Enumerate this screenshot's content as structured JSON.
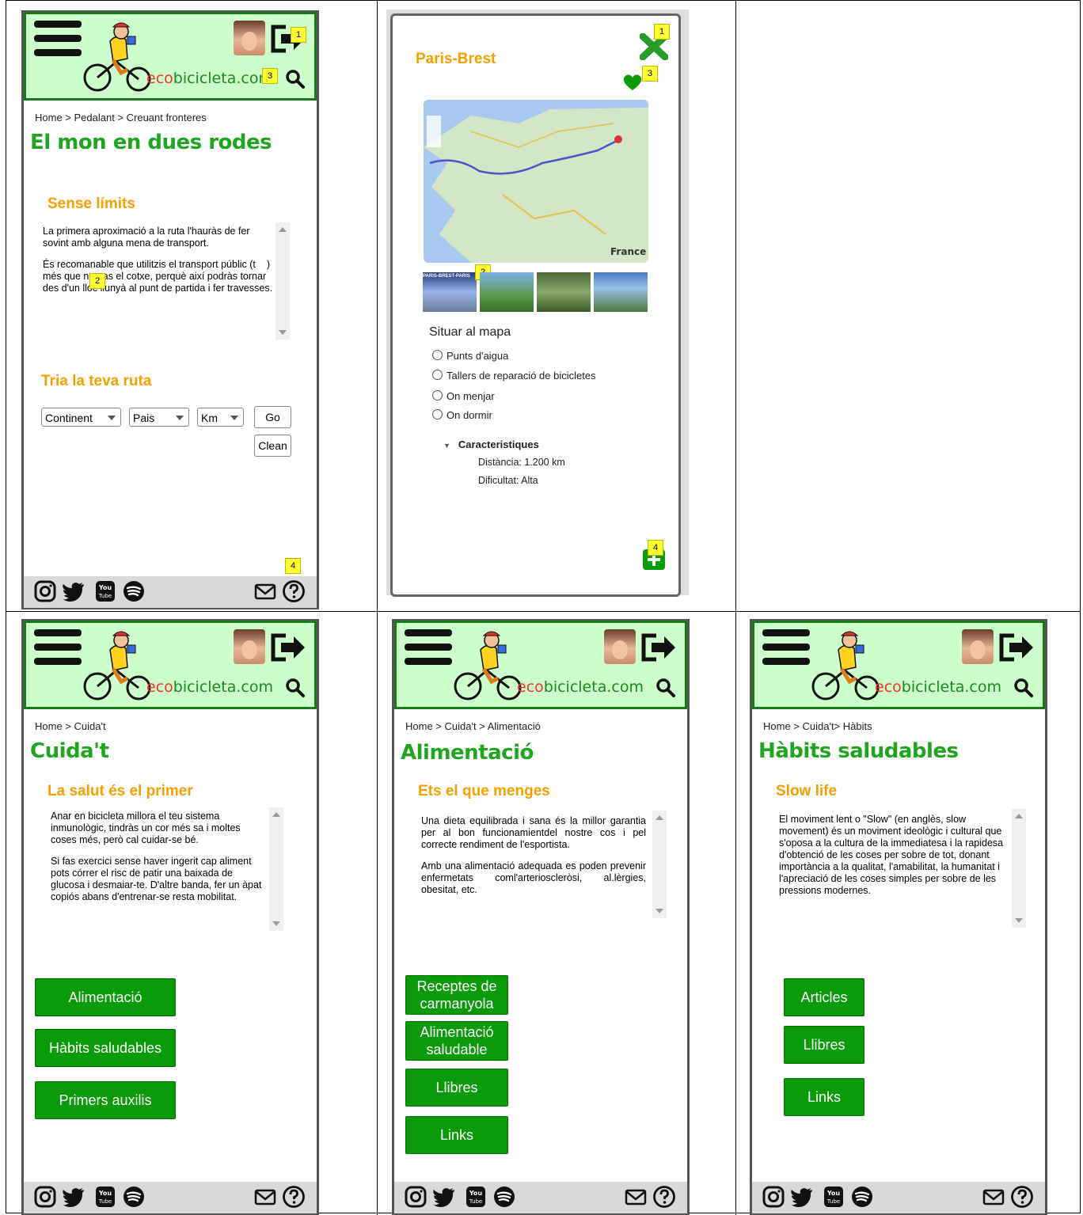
{
  "brand": {
    "eco": "eco",
    "rest": "bicicleta.com"
  },
  "screens": {
    "travel": {
      "breadcrumb": "Home > Pedalant > Creuant fronteres",
      "title": "El mon en dues rodes",
      "section": "Sense límits",
      "para1": "La primera aproximació a la ruta l'hauràs de fer sovint amb alguna mena de transport.",
      "para2": "És recomanable que utilitzis el transport públic (t",
      "para2b": ") més que no pas el cotxe, perquè així podràs tornar des d'un lloc llunyà al punt de partida i fer travesses.",
      "route_title": "Tria la teva ruta",
      "select_continent": "Continent",
      "select_country": "Pais",
      "select_km": "Km",
      "go": "Go",
      "clean": "Clean"
    },
    "route": {
      "title": "Paris-Brest",
      "map_country": "France",
      "photo_label": "PARIS-BREST-PARIS",
      "situate": "Situar al mapa",
      "options": [
        "Punts d'aigua",
        "Tallers de reparació de bicicletes",
        "On menjar",
        "On dormir"
      ],
      "details_title": "Caracteristiques",
      "distance": "Distància: 1.200 km",
      "difficulty": "Dificultat: Alta"
    },
    "cuidat": {
      "breadcrumb": "Home > Cuida't",
      "title": "Cuida't",
      "section": "La salut és el primer",
      "para1": "Anar en bicicleta millora el teu sistema inmunològic, tindràs un cor més sa i moltes coses més, però cal cuidar-se bé.",
      "para2": "Si fas exercici sense haver ingerit cap aliment pots córrer el risc de patir una baixada de glucosa i desmaiar-te. D'altre banda, fer un àpat copiós abans d'entrenar-se resta mobilitat.",
      "buttons": [
        "Alimentació",
        "Hàbits saludables",
        "Primers auxilis"
      ]
    },
    "alimentacio": {
      "breadcrumb": "Home > Cuida't > Alimentació",
      "title": "Alimentació",
      "section": "Ets el que menges",
      "para1": "Una dieta equilibrada i sana és la millor garantia per al bon funcionamientdel nostre cos i pel correcte rendiment de l'esportista.",
      "para2": "Amb una alimentació adequada es poden prevenir enfermetats coml'arterioscleròsi, al.lèrgies, obesitat, etc.",
      "buttons": [
        "Receptes de carmanyola",
        "Alimentació saludable",
        "Llibres",
        "Links"
      ]
    },
    "habits": {
      "breadcrumb": "Home > Cuida't> Hàbits",
      "title": "Hàbits saludables",
      "section": "Slow life",
      "para1": "El moviment lent o \"Slow\" (en anglès, slow movement) és un moviment ideològic i cultural que s'oposa a la cultura de la immediatesa i la rapidesa d'obtenció de les coses per sobre de tot, donant importància a la qualitat, l'amabilitat, la humanitat i l'apreciació de les coses simples per sobre de les pressions modernes.",
      "buttons": [
        "Articles",
        "Llibres",
        "Links"
      ]
    }
  },
  "badges": [
    "1",
    "2",
    "3",
    "4"
  ],
  "colors": {
    "header_bg": "#ccffcc",
    "header_border": "#1a7a1a",
    "title": "#1fa51f",
    "section": "#f4a000",
    "button": "#0a9a0a"
  },
  "icons": [
    "hamburger-menu-icon",
    "cyclist-logo-icon",
    "user-avatar-icon",
    "logout-icon",
    "search-icon",
    "instagram-icon",
    "twitter-icon",
    "youtube-icon",
    "spotify-icon",
    "mail-icon",
    "help-icon",
    "close-icon",
    "heart-icon",
    "add-icon"
  ]
}
